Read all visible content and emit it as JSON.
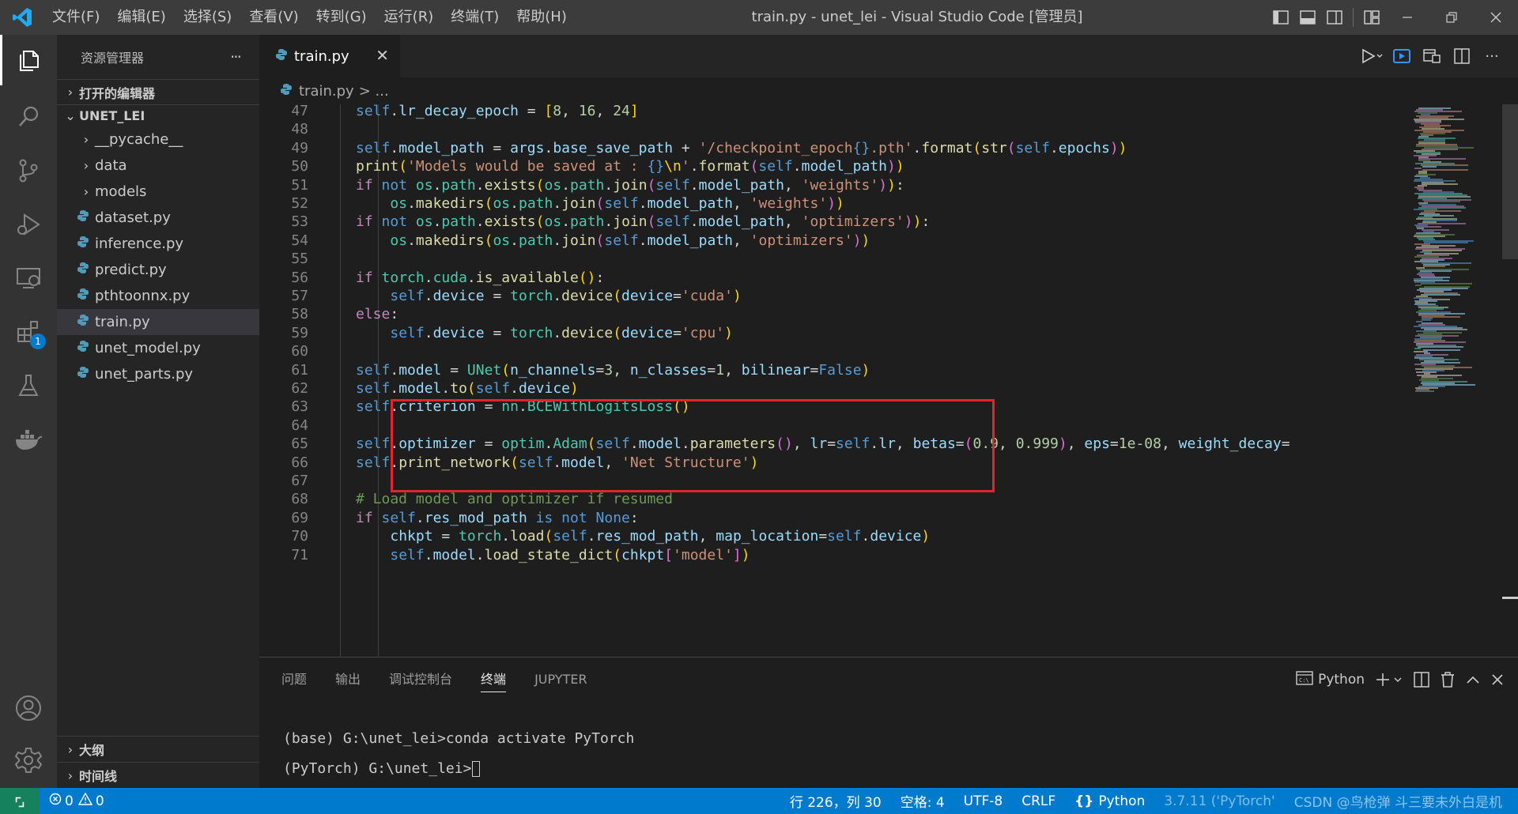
{
  "window": {
    "title": "train.py - unet_lei - Visual Studio Code [管理员]",
    "menu": [
      "文件(F)",
      "编辑(E)",
      "选择(S)",
      "查看(V)",
      "转到(G)",
      "运行(R)",
      "终端(T)",
      "帮助(H)"
    ]
  },
  "activity_bar": {
    "items": [
      "explorer-icon",
      "search-icon",
      "source-control-icon",
      "run-debug-icon",
      "remote-explorer-icon",
      "extensions-icon",
      "testing-icon",
      "docker-icon"
    ],
    "extensions_badge": "1",
    "bottom": [
      "account-icon",
      "settings-gear-icon"
    ]
  },
  "sidebar": {
    "title": "资源管理器",
    "more": "···",
    "open_editors": "打开的编辑器",
    "folder": "UNET_LEI",
    "items": [
      {
        "label": "__pycache__",
        "type": "folder"
      },
      {
        "label": "data",
        "type": "folder"
      },
      {
        "label": "models",
        "type": "folder"
      },
      {
        "label": "dataset.py",
        "type": "file"
      },
      {
        "label": "inference.py",
        "type": "file"
      },
      {
        "label": "predict.py",
        "type": "file"
      },
      {
        "label": "pthtoonnx.py",
        "type": "file"
      },
      {
        "label": "train.py",
        "type": "file",
        "selected": true
      },
      {
        "label": "unet_model.py",
        "type": "file"
      },
      {
        "label": "unet_parts.py",
        "type": "file"
      }
    ],
    "outline": "大纲",
    "timeline": "时间线"
  },
  "editor": {
    "tab": "train.py",
    "tab_close": "✕",
    "breadcrumb_file": "train.py",
    "breadcrumb_more": "> ...",
    "lines": [
      {
        "n": "47",
        "code": "        self.lr_decay_epoch = [8, 16, 24]"
      },
      {
        "n": "48",
        "code": ""
      },
      {
        "n": "49",
        "code": "        self.model_path = args.base_save_path + '/checkpoint_epoch{}.pth'.format(str(self.epochs))"
      },
      {
        "n": "50",
        "code": "        print('Models would be saved at : {}\\n'.format(self.model_path))"
      },
      {
        "n": "51",
        "code": "        if not os.path.exists(os.path.join(self.model_path, 'weights')):"
      },
      {
        "n": "52",
        "code": "            os.makedirs(os.path.join(self.model_path, 'weights'))"
      },
      {
        "n": "53",
        "code": "        if not os.path.exists(os.path.join(self.model_path, 'optimizers')):"
      },
      {
        "n": "54",
        "code": "            os.makedirs(os.path.join(self.model_path, 'optimizers'))"
      },
      {
        "n": "55",
        "code": ""
      },
      {
        "n": "56",
        "code": "        if torch.cuda.is_available():"
      },
      {
        "n": "57",
        "code": "            self.device = torch.device(device='cuda')"
      },
      {
        "n": "58",
        "code": "        else:"
      },
      {
        "n": "59",
        "code": "            self.device = torch.device(device='cpu')"
      },
      {
        "n": "60",
        "code": ""
      },
      {
        "n": "61",
        "code": "        self.model = UNet(n_channels=3, n_classes=1, bilinear=False)"
      },
      {
        "n": "62",
        "code": "        self.model.to(self.device)"
      },
      {
        "n": "63",
        "code": "        self.criterion = nn.BCEWithLogitsLoss()"
      },
      {
        "n": "64",
        "code": ""
      },
      {
        "n": "65",
        "code": "        self.optimizer = optim.Adam(self.model.parameters(), lr=self.lr, betas=(0.9, 0.999), eps=1e-08, weight_decay="
      },
      {
        "n": "66",
        "code": "        self.print_network(self.model, 'Net Structure')"
      },
      {
        "n": "67",
        "code": ""
      },
      {
        "n": "68",
        "code": "        # Load model and optimizer if resumed"
      },
      {
        "n": "69",
        "code": "        if self.res_mod_path is not None:"
      },
      {
        "n": "70",
        "code": "            chkpt = torch.load(self.res_mod_path, map_location=self.device)"
      },
      {
        "n": "71",
        "code": "            self.model.load_state_dict(chkpt['model'])"
      }
    ]
  },
  "panel": {
    "tabs": [
      "问题",
      "输出",
      "调试控制台",
      "终端",
      "JUPYTER"
    ],
    "active_tab": "终端",
    "terminal_name": "Python",
    "terminal_lines": [
      "(base) G:\\unet_lei>conda activate PyTorch",
      "(PyTorch) G:\\unet_lei>"
    ]
  },
  "statusbar": {
    "errors": "0",
    "warnings": "0",
    "position": "行 226，列 30",
    "spaces": "空格: 4",
    "encoding": "UTF-8",
    "eol": "CRLF",
    "language": "Python",
    "interpreter": "3.7.11 ('PyTorch'",
    "watermark": "CSDN @鸟枪弹 斗三要未外白是机"
  },
  "colors": {
    "accent": "#007acc",
    "highlight_box": "#e0262b",
    "remote": "#16825d"
  }
}
